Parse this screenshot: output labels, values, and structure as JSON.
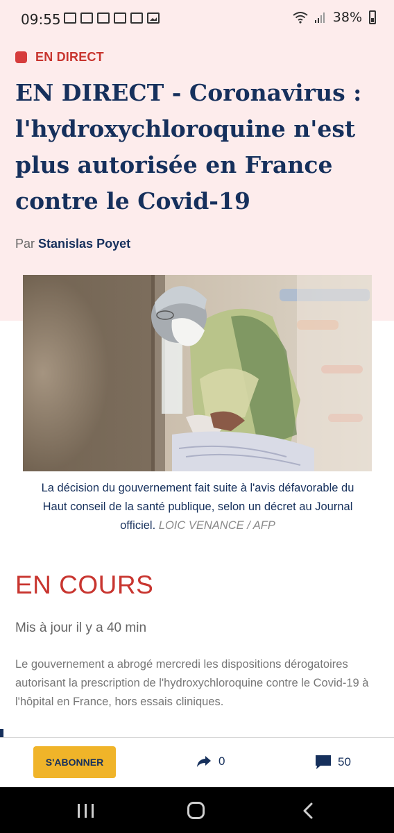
{
  "status_bar": {
    "time": "09:55",
    "battery": "38%",
    "left_icons": [
      "mail-icon",
      "calendar-icon",
      "mail-icon",
      "calendar-icon",
      "app-icon",
      "gallery-icon"
    ],
    "right_icons": [
      "wifi-icon",
      "signal-icon",
      "battery-icon"
    ]
  },
  "article": {
    "live_label": "EN DIRECT",
    "headline": "EN DIRECT - Coronavirus : l'hydroxychloroquine n'est plus autorisée en France contre le Covid-19",
    "byline_prefix": "Par",
    "author": "Stanislas Poyet",
    "photo_caption": "La décision du gouvernement fait suite à l'avis défavorable du Haut conseil de la santé publique, selon un décret au Journal officiel.",
    "photo_credit": "LOIC VENANCE / AFP"
  },
  "live": {
    "status": "EN COURS",
    "updated": "Mis à jour il y a 40 min",
    "summary": "Le gouvernement a abrogé mercredi les dispositions dérogatoires autorisant la prescription de l'hydroxychloroquine contre le Covid-19 à l'hôpital en France, hors essais cliniques."
  },
  "action_bar": {
    "subscribe_label": "S'ABONNER",
    "share_count": "0",
    "comment_count": "50"
  },
  "colors": {
    "navy": "#16305c",
    "live_red": "#c8352f",
    "header_bg": "#fdecec",
    "subscribe_yellow": "#f0b429"
  }
}
